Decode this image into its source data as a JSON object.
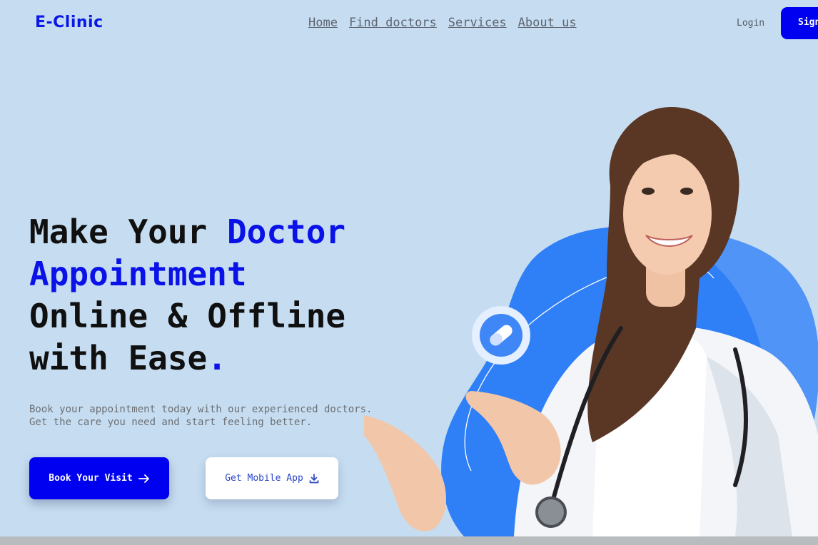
{
  "brand": {
    "name": "E-Clinic"
  },
  "nav": {
    "items": [
      "Home",
      "Find doctors",
      "Services",
      "About us"
    ]
  },
  "auth": {
    "login": "Login",
    "signup": "Sign"
  },
  "hero": {
    "title_line1_a": "Make Your ",
    "title_line1_b": "Doctor",
    "title_line2": "Appointment",
    "title_line3": "Online & Offline",
    "title_line4": "with Ease",
    "title_dot": ".",
    "subtitle_line1": "Book your appointment today with our experienced doctors.",
    "subtitle_line2": "Get the care you need and start feeling better.",
    "primary_cta": "Book Your Visit",
    "secondary_cta": "Get Mobile App"
  },
  "colors": {
    "background": "#c6ddf1",
    "brand": "#0a18e6",
    "accent": "#0000f0",
    "blob": "#2f7ff6"
  },
  "icons": {
    "primary_cta": "arrow-right-icon",
    "secondary_cta": "download-icon",
    "badge": "pill-icon"
  }
}
